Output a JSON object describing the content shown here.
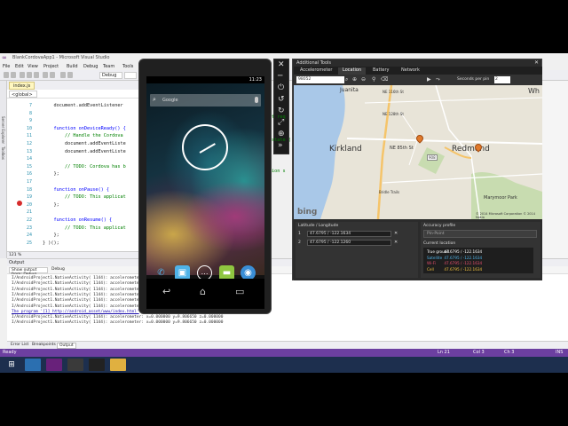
{
  "vs": {
    "title": "BlankCordovaApp1 - Microsoft Visual Studio",
    "menu": [
      "File",
      "Edit",
      "View",
      "Project",
      "Build",
      "Debug",
      "Team",
      "Tools"
    ],
    "config": "Debug",
    "doc_tab": "index.js",
    "nav_dropdown": "<global>",
    "side_labels": [
      "Server Explorer",
      "Toolbox"
    ],
    "zoom": "121 %",
    "code_lines": [
      {
        "n": "7",
        "text": "    document.addEventListener"
      },
      {
        "n": "8",
        "text": ""
      },
      {
        "n": "9",
        "text": ""
      },
      {
        "n": "10",
        "text": "    function onDeviceReady() {"
      },
      {
        "n": "11",
        "text": "        // Handle the Cordova"
      },
      {
        "n": "12",
        "text": "        document.addEventListe"
      },
      {
        "n": "13",
        "text": "        document.addEventListe"
      },
      {
        "n": "14",
        "text": ""
      },
      {
        "n": "15",
        "text": "        // TODO: Cordova has b"
      },
      {
        "n": "16",
        "text": "    };"
      },
      {
        "n": "17",
        "text": ""
      },
      {
        "n": "18",
        "text": "    function onPause() {"
      },
      {
        "n": "19",
        "text": "        // TODO: This applicat"
      },
      {
        "n": "20",
        "text": "    };"
      },
      {
        "n": "21",
        "text": ""
      },
      {
        "n": "22",
        "text": "    function onResume() {"
      },
      {
        "n": "23",
        "text": "        // TODO: This applicat"
      },
      {
        "n": "24",
        "text": "    };"
      },
      {
        "n": "25",
        "text": "} )();"
      }
    ],
    "code_overflow": [
      "t req",
      "state (",
      "ion s"
    ],
    "output_title": "Output",
    "output_source": "Show output from: Debug",
    "output_source2": "Debug",
    "output_lines": [
      "I/AndroidProject1.NativeActivity( 1144): accelerometer",
      "I/AndroidProject1.NativeActivity( 1144): accelerometer",
      "I/AndroidProject1.NativeActivity( 1144): accelerometer",
      "I/AndroidProject1.NativeActivity( 1144): accelerometer",
      "I/AndroidProject1.NativeActivity( 1144): accelerometer",
      "I/AndroidProject1.NativeActivity( 1144): accelerometer"
    ],
    "output_progress": "The program '[1] http://android_asset/www/index.html'",
    "output_tail": [
      "I/AndroidProject1.NativeActivity( 1144): accelerometer: x=0.000000 y=9.806650 z=0.000000",
      "I/AndroidProject1.NativeActivity( 1144): accelerometer: x=0.000000 y=9.806650 z=0.000000"
    ],
    "bottom_tabs": [
      "Error List",
      "Breakpoints",
      "Output"
    ],
    "status_left": "Ready",
    "status_ln": "Ln 21",
    "status_col": "Col 3",
    "status_ch": "Ch 3",
    "status_ins": "INS",
    "solution_label": "Quick Launch"
  },
  "emulator": {
    "time": "11:23",
    "search_label": "Google",
    "tools": [
      "✕",
      "─",
      "⏻",
      "↺",
      "↻",
      "⤢",
      "⊕",
      "»"
    ]
  },
  "additional_tools": {
    "title": "Additional Tools",
    "tabs": [
      "Accelerometer",
      "Location",
      "Battery",
      "Network"
    ],
    "active_tab": "Location",
    "search_value": "98052",
    "seconds_label": "Seconds per pin",
    "seconds_value": "2",
    "map_labels": [
      {
        "text": "Juanita",
        "size": 6
      },
      {
        "text": "NE 116th St",
        "size": 4
      },
      {
        "text": "Kirkland",
        "size": 9
      },
      {
        "text": "NE 85th St",
        "size": 5
      },
      {
        "text": "Redmond",
        "size": 9
      },
      {
        "text": "Wh",
        "size": 8
      },
      {
        "text": "Marymoor Park",
        "size": 5
      },
      {
        "text": "Bridle Trails",
        "size": 4
      },
      {
        "text": "NE 128th St",
        "size": 4
      },
      {
        "text": "908",
        "size": 4
      }
    ],
    "copyright": "© 2014 Microsoft Corporation  © 2014 Nokia",
    "bing": "bing",
    "points_header": "Latitude / Longitude",
    "points": [
      {
        "num": "1",
        "value": "47.6795 / -122.1634"
      },
      {
        "num": "2",
        "value": "47.6795 / -122.1260"
      }
    ],
    "accuracy_header": "Accuracy profile",
    "accuracy_value": "Pin-Point",
    "current_location_header": "Current location",
    "current_location": [
      {
        "name": "True ground",
        "value": "47.6795 / -122.1634",
        "color": "#ffffff"
      },
      {
        "name": "Satellite",
        "value": "47.6795 / -122.1634",
        "color": "#4fb3e8"
      },
      {
        "name": "Wi-Fi",
        "value": "47.6795 / -122.1634",
        "color": "#e84f6e"
      },
      {
        "name": "Cell",
        "value": "47.6795 / -122.1634",
        "color": "#f0c040"
      }
    ]
  },
  "taskbar": {
    "time": "",
    "date": ""
  },
  "colors": {
    "vs_accent": "#68217a",
    "status_bar": "#6c3fa0",
    "taskbar": "#1d2f4e"
  }
}
